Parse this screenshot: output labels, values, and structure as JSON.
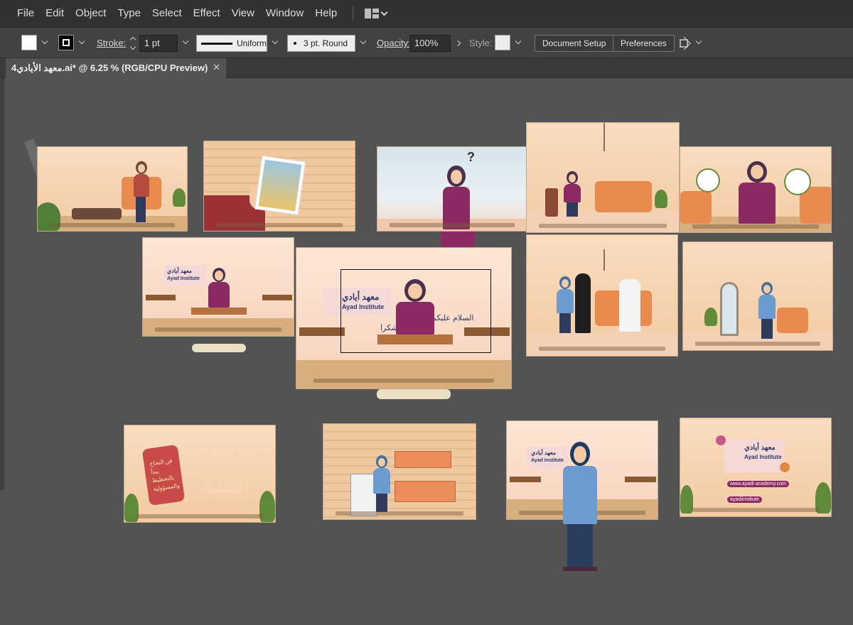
{
  "menubar": {
    "items": [
      "File",
      "Edit",
      "Object",
      "Type",
      "Select",
      "Effect",
      "View",
      "Window",
      "Help"
    ]
  },
  "controlbar": {
    "stroke_label": "Stroke:",
    "stroke_weight": "1 pt",
    "stroke_profile": "Uniform",
    "brush": "3 pt. Round",
    "opacity_label": "Opacity:",
    "opacity_value": "100%",
    "style_label": "Style:",
    "document_setup": "Document Setup",
    "preferences": "Preferences"
  },
  "document": {
    "tab_title": "معهد الأيادي4.ai* @ 6.25 % (RGB/CPU Preview)",
    "close_glyph": "✕"
  },
  "artboards": {
    "logo_ar": "معهد أيادي",
    "logo_en": "Ayad Institute",
    "greeting_ar": "السلام عليكم",
    "thanks_ar": "شكرا",
    "details_ar_1": "التفاصيل",
    "details_ar_2": "التقنية",
    "phone_text": "فن النجاح يبدأ بالتخطيط والمسؤولية",
    "contact_site": "www.ayadi-academy.com",
    "contact_handle": "ayadiinstitute",
    "question_glyph": "?"
  },
  "colors": {
    "menubar_bg": "#323232",
    "controlbar_bg": "#424242",
    "canvas_bg": "#535353",
    "accent_purple": "#8c2a63",
    "accent_orange": "#e98a4e"
  }
}
